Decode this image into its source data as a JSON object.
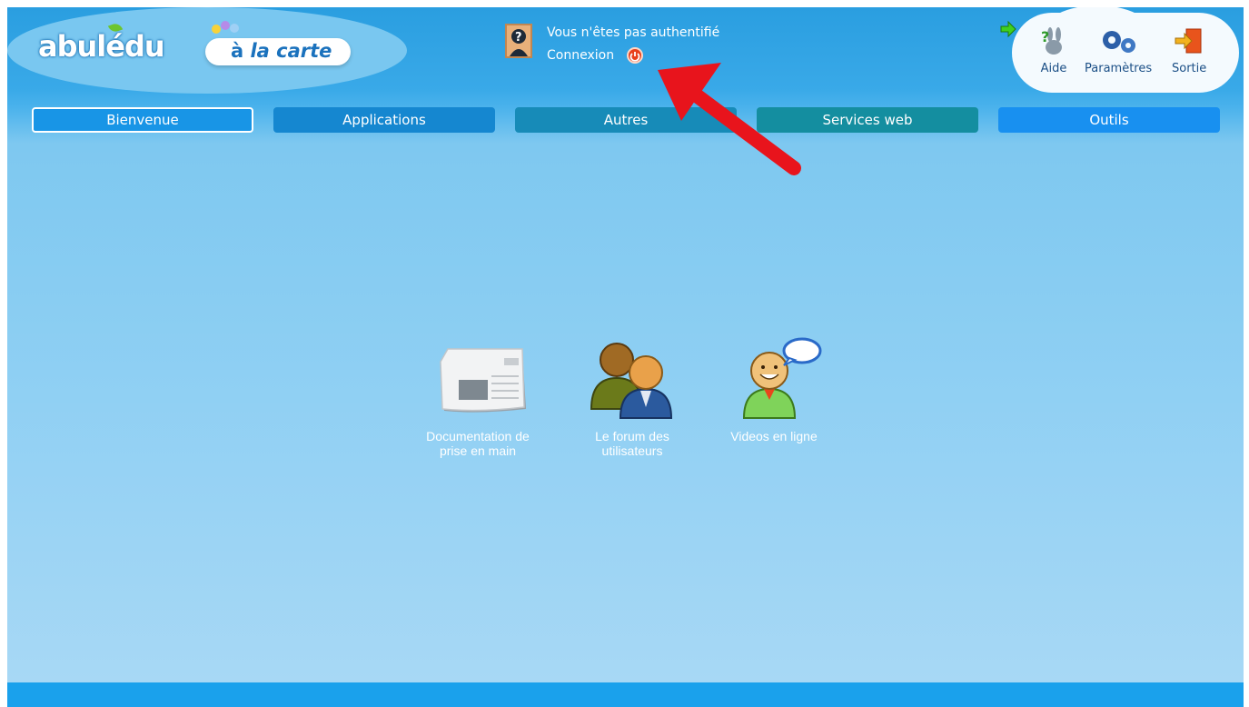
{
  "header": {
    "logo_text": "abulédu",
    "subtitle_prefix": "à",
    "subtitle_text": "la carte",
    "user_status": "Vous n'êtes pas authentifié",
    "login_label": "Connexion"
  },
  "tools": [
    {
      "label": "Aide",
      "icon": "help-rabbit-icon"
    },
    {
      "label": "Paramètres",
      "icon": "gears-icon"
    },
    {
      "label": "Sortie",
      "icon": "exit-door-icon"
    }
  ],
  "nav": {
    "tabs": [
      {
        "label": "Bienvenue",
        "active": true
      },
      {
        "label": "Applications"
      },
      {
        "label": "Autres"
      },
      {
        "label": "Services web"
      },
      {
        "label": "Outils"
      }
    ]
  },
  "apps": [
    {
      "label_line1": "Documentation de",
      "label_line2": "prise en main",
      "icon": "newspaper-icon"
    },
    {
      "label_line1": "Le forum des",
      "label_line2": "utilisateurs",
      "icon": "users-icon"
    },
    {
      "label_line1": "Videos en ligne",
      "label_line2": "",
      "icon": "user-chat-icon"
    }
  ],
  "colors": {
    "header_blue": "#2a9ee0",
    "content_blue": "#8ecff3",
    "footer_blue": "#1aa1ec",
    "annotation_red": "#e8141c"
  }
}
